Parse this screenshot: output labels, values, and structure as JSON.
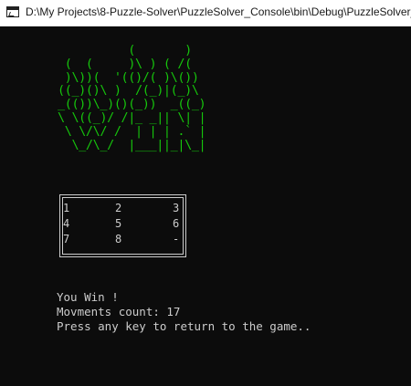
{
  "window": {
    "title": "D:\\My Projects\\8-Puzzle-Solver\\PuzzleSolver_Console\\bin\\Debug\\PuzzleSolver_C"
  },
  "banner": {
    "ascii_art": "          (       )\n (  (     )\\ ) ( /(\n )\\))(  '(()/( )\\())\n((_)()\\ )  /(_)|(_)\\\n_(())\\_)()(_))  _((_)\n\\ \\((_)/ /|_ _|| \\| |\n \\ \\/\\/ /  | | | .` |\n  \\_/\\_/  |___||_|\\_|",
    "color": "#16c60c"
  },
  "board": {
    "cells": [
      "1",
      "2",
      "3",
      "4",
      "5",
      "6",
      "7",
      "8",
      "-"
    ],
    "border_color": "#cccccc"
  },
  "messages": {
    "result": "You Win !",
    "moves": "Movments count: 17",
    "prompt": "Press any key to return to the game.."
  },
  "colors": {
    "background": "#0c0c0c",
    "text": "#cccccc"
  }
}
